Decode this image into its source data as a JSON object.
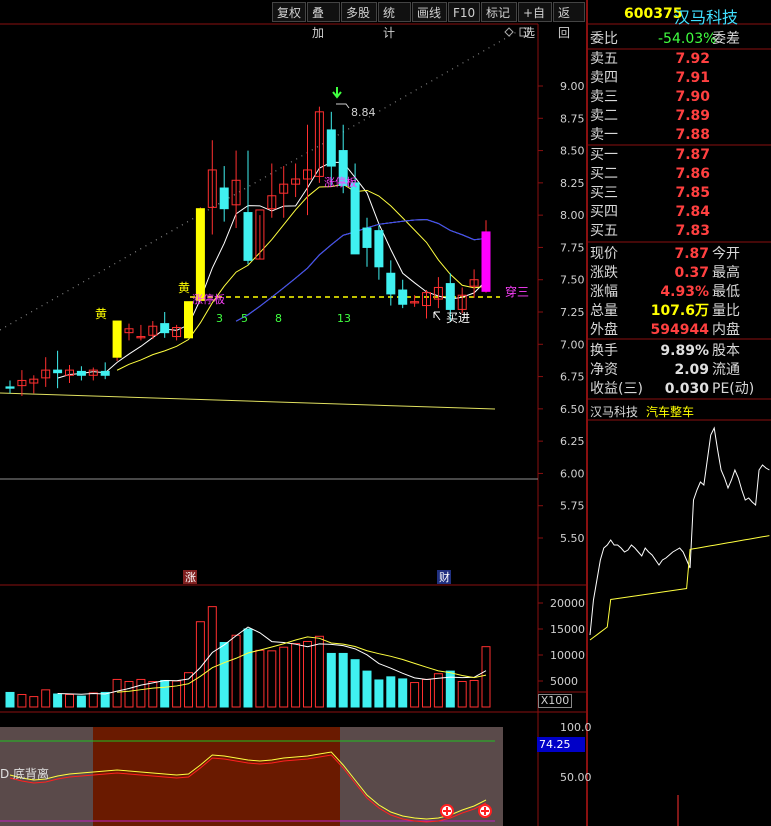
{
  "toolbar": {
    "buttons": [
      "复权",
      "叠加",
      "多股",
      "统计",
      "画线",
      "F10",
      "标记",
      "+自选",
      "返回"
    ]
  },
  "stock": {
    "code": "600375",
    "name": "汉马科技"
  },
  "order_book": {
    "weibi_label": "委比",
    "weibi_value": "-54.03%",
    "weicha_label": "委差",
    "asks": [
      {
        "label": "卖五",
        "price": "7.92"
      },
      {
        "label": "卖四",
        "price": "7.91"
      },
      {
        "label": "卖三",
        "price": "7.90"
      },
      {
        "label": "卖二",
        "price": "7.89"
      },
      {
        "label": "卖一",
        "price": "7.88"
      }
    ],
    "bids": [
      {
        "label": "买一",
        "price": "7.87"
      },
      {
        "label": "买二",
        "price": "7.86"
      },
      {
        "label": "买三",
        "price": "7.85"
      },
      {
        "label": "买四",
        "price": "7.84"
      },
      {
        "label": "买五",
        "price": "7.83"
      }
    ]
  },
  "quote": [
    {
      "label": "现价",
      "value": "7.87",
      "label2": "今开"
    },
    {
      "label": "涨跌",
      "value": "0.37",
      "label2": "最高"
    },
    {
      "label": "涨幅",
      "value": "4.93%",
      "label2": "最低"
    },
    {
      "label": "总量",
      "value": "107.6万",
      "label2": "量比"
    },
    {
      "label": "外盘",
      "value": "594944",
      "label2": "内盘"
    }
  ],
  "stats": [
    {
      "label": "换手",
      "value": "9.89%",
      "label2": "股本"
    },
    {
      "label": "净资",
      "value": "2.09",
      "label2": "流通"
    },
    {
      "label": "收益(三)",
      "value": "0.030",
      "label2": "PE(动)"
    }
  ],
  "intraday": {
    "name": "汉马科技",
    "sector": "汽车整车"
  },
  "chart_data": {
    "type": "candlestick",
    "price_axis_ticks": [
      "9.00",
      "8.75",
      "8.50",
      "8.25",
      "8.00",
      "7.75",
      "7.50",
      "7.25",
      "7.00",
      "6.75",
      "6.50",
      "6.25",
      "6.00",
      "5.75",
      "5.50"
    ],
    "volume_axis_ticks": [
      "20000",
      "15000",
      "10000",
      "5000"
    ],
    "volume_unit": "X100",
    "indicator_axis_ticks": [
      "100.0",
      "50.00"
    ],
    "indicator_value": "74.25",
    "indicator_name": "D 底背离",
    "high_marker": "8.84",
    "annotations": [
      "黄",
      "黄",
      "涨停板",
      "涨停板",
      "3",
      "5",
      "8",
      "13",
      "买进",
      "穿三",
      "涨",
      "财"
    ],
    "candles": [
      {
        "o": 6.67,
        "h": 6.72,
        "l": 6.62,
        "c": 6.66
      },
      {
        "o": 6.68,
        "h": 6.8,
        "l": 6.6,
        "c": 6.72
      },
      {
        "o": 6.7,
        "h": 6.76,
        "l": 6.62,
        "c": 6.73
      },
      {
        "o": 6.74,
        "h": 6.9,
        "l": 6.67,
        "c": 6.8
      },
      {
        "o": 6.8,
        "h": 6.95,
        "l": 6.66,
        "c": 6.78
      },
      {
        "o": 6.76,
        "h": 6.84,
        "l": 6.7,
        "c": 6.8
      },
      {
        "o": 6.79,
        "h": 6.83,
        "l": 6.72,
        "c": 6.76
      },
      {
        "o": 6.76,
        "h": 6.82,
        "l": 6.72,
        "c": 6.8
      },
      {
        "o": 6.79,
        "h": 6.86,
        "l": 6.73,
        "c": 6.76
      },
      {
        "o": 6.9,
        "h": 7.05,
        "l": 6.87,
        "c": 7.18
      },
      {
        "o": 7.09,
        "h": 7.16,
        "l": 7.03,
        "c": 7.12
      },
      {
        "o": 7.05,
        "h": 7.15,
        "l": 7.03,
        "c": 7.06
      },
      {
        "o": 7.07,
        "h": 7.18,
        "l": 7.04,
        "c": 7.14
      },
      {
        "o": 7.16,
        "h": 7.25,
        "l": 7.05,
        "c": 7.09
      },
      {
        "o": 7.06,
        "h": 7.15,
        "l": 7.03,
        "c": 7.13
      },
      {
        "o": 7.05,
        "h": 7.3,
        "l": 7.05,
        "c": 7.33
      },
      {
        "o": 7.34,
        "h": 8.06,
        "l": 7.34,
        "c": 8.05
      },
      {
        "o": 8.06,
        "h": 8.58,
        "l": 7.85,
        "c": 8.35
      },
      {
        "o": 8.21,
        "h": 8.38,
        "l": 7.95,
        "c": 8.05
      },
      {
        "o": 8.08,
        "h": 8.5,
        "l": 7.9,
        "c": 8.27
      },
      {
        "o": 8.02,
        "h": 8.5,
        "l": 7.62,
        "c": 7.65
      },
      {
        "o": 7.66,
        "h": 8.0,
        "l": 7.66,
        "c": 8.04
      },
      {
        "o": 8.05,
        "h": 8.4,
        "l": 7.98,
        "c": 8.15
      },
      {
        "o": 8.17,
        "h": 8.38,
        "l": 7.98,
        "c": 8.24
      },
      {
        "o": 8.24,
        "h": 8.4,
        "l": 8.14,
        "c": 8.28
      },
      {
        "o": 8.28,
        "h": 8.7,
        "l": 8.0,
        "c": 8.35
      },
      {
        "o": 8.3,
        "h": 8.84,
        "l": 8.25,
        "c": 8.8
      },
      {
        "o": 8.66,
        "h": 8.8,
        "l": 8.23,
        "c": 8.38
      },
      {
        "o": 8.5,
        "h": 8.7,
        "l": 8.17,
        "c": 8.23
      },
      {
        "o": 8.25,
        "h": 8.4,
        "l": 7.7,
        "c": 7.7
      },
      {
        "o": 7.9,
        "h": 7.98,
        "l": 7.6,
        "c": 7.75
      },
      {
        "o": 7.88,
        "h": 7.92,
        "l": 7.5,
        "c": 7.6
      },
      {
        "o": 7.55,
        "h": 7.65,
        "l": 7.3,
        "c": 7.39
      },
      {
        "o": 7.42,
        "h": 7.5,
        "l": 7.28,
        "c": 7.31
      },
      {
        "o": 7.32,
        "h": 7.38,
        "l": 7.29,
        "c": 7.33
      },
      {
        "o": 7.3,
        "h": 7.42,
        "l": 7.2,
        "c": 7.4
      },
      {
        "o": 7.35,
        "h": 7.52,
        "l": 7.28,
        "c": 7.44
      },
      {
        "o": 7.47,
        "h": 7.55,
        "l": 7.18,
        "c": 7.27
      },
      {
        "o": 7.27,
        "h": 7.44,
        "l": 7.24,
        "c": 7.38
      },
      {
        "o": 7.45,
        "h": 7.58,
        "l": 7.36,
        "c": 7.5
      },
      {
        "o": 7.41,
        "h": 7.96,
        "l": 7.4,
        "c": 7.87
      }
    ],
    "volumes": [
      2800,
      2400,
      2000,
      3300,
      2500,
      2400,
      2100,
      2700,
      2800,
      5300,
      4900,
      5300,
      4900,
      5100,
      5000,
      6600,
      16400,
      19300,
      12400,
      13800,
      15000,
      10900,
      10800,
      11500,
      12200,
      12600,
      13600,
      10300,
      10300,
      9100,
      6900,
      5200,
      5800,
      5400,
      4700,
      5300,
      6400,
      6900,
      4900,
      5100,
      11600
    ]
  }
}
